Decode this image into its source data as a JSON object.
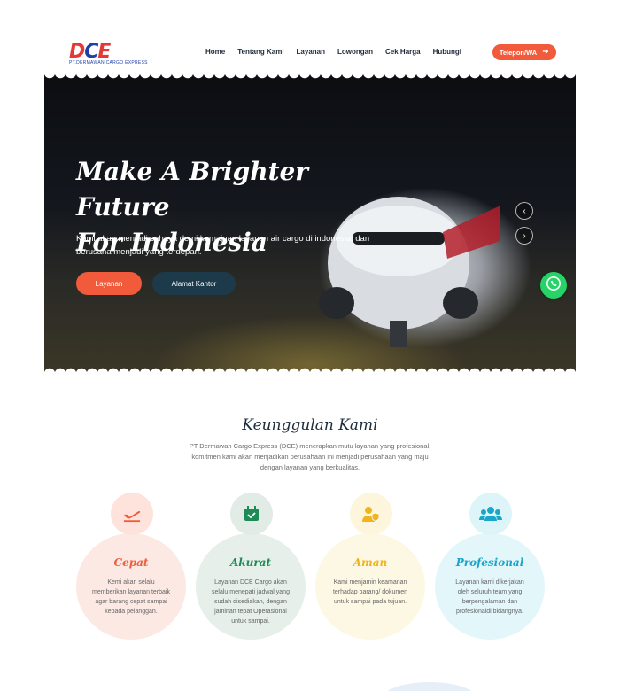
{
  "header": {
    "logo_letters": [
      "D",
      "C",
      "E"
    ],
    "logo_sub": "PT.DERMAWAN CARGO EXPRESS",
    "nav": [
      "Home",
      "Tentang Kami",
      "Layanan",
      "Lowongan",
      "Cek Harga",
      "Hubungi"
    ],
    "cta_label": "Telepon/WA"
  },
  "hero": {
    "title_line1": "Make A Brighter Future",
    "title_line2": "For Indonesia",
    "subtitle": "Kami akan menjadi cahaya demi kemajuan layanan air cargo di indonesia, dan berusaha menjadi yang terdepan.",
    "btn_primary": "Layanan",
    "btn_secondary": "Alamat Kantor"
  },
  "section": {
    "title": "Keunggulan Kami",
    "description": "PT Dermawan Cargo Express (DCE) menerapkan mutu layanan yang profesional, komitmen kami akan menjadikan perusahaan ini menjadi perusahaan yang maju dengan layanan yang berkualitas."
  },
  "features": [
    {
      "title": "Cepat",
      "icon": "plane-departure-icon",
      "text": "Kemi akan selalu memberikan layanan terbaik agar barang cepat sampai kepada pelanggan.",
      "color": "#f15a3a",
      "bg": "#fde9e4",
      "icon_bg": "#fde3dc"
    },
    {
      "title": "Akurat",
      "icon": "calendar-check-icon",
      "text": "Layanan DCE Cargo akan selalu menepati jadwal yang sudah disediakan, dengan jaminan tepat Operasional untuk sampai.",
      "color": "#1e8a56",
      "bg": "#e6efea",
      "icon_bg": "#e1ece6"
    },
    {
      "title": "Aman",
      "icon": "user-shield-icon",
      "text": "Kami menjamin keamanan terhadap barang/ dokumen untuk sampai pada tujuan.",
      "color": "#f0b51e",
      "bg": "#fdf8e3",
      "icon_bg": "#fdf6dc"
    },
    {
      "title": "Profesional",
      "icon": "users-icon",
      "text": "Layanan kami dikerjakan oleh seluruh team yang berpengalaman dan profesionaldi bidangnya.",
      "color": "#1aa6c8",
      "bg": "#e3f6fa",
      "icon_bg": "#ddf4f8"
    }
  ]
}
